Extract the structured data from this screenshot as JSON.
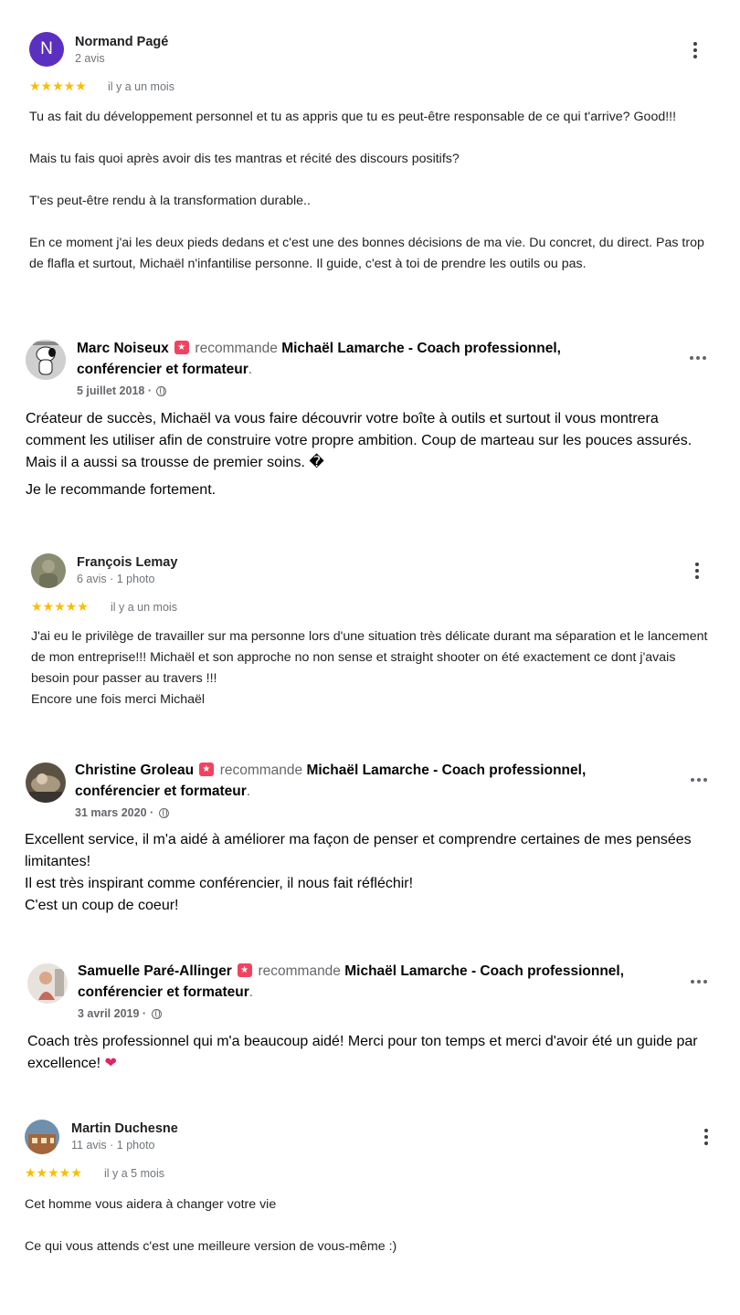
{
  "reviews": [
    {
      "type": "google",
      "avatar_letter": "N",
      "name": "Normand Pagé",
      "meta": "2 avis",
      "stars": "★★★★★",
      "time": "il y a un mois",
      "paragraphs": [
        "Tu as fait du développement personnel et tu as appris que tu es peut-être responsable de ce qui t'arrive? Good!!!",
        "Mais tu fais quoi après avoir dis tes mantras et récité des discours positifs?",
        "T'es peut-être rendu à la transformation durable..",
        "En ce moment j'ai les deux pieds dedans et c'est une des bonnes décisions de ma vie. Du concret, du direct. Pas trop de flafla et surtout, Michaël n'infantilise personne. Il guide, c'est à toi de prendre les outils ou pas."
      ]
    },
    {
      "type": "facebook",
      "name": "Marc Noiseux",
      "recommends": "recommande",
      "page": "Michaël Lamarche - Coach professionnel, conférencier et formateur",
      "date": "5 juillet 2018 ·",
      "paragraphs": [
        "Créateur de succès, Michaël va vous faire découvrir  votre boîte à outils et surtout il vous montrera comment les utiliser afin de construire votre propre ambition. Coup de marteau sur les pouces assurés. Mais il a aussi sa trousse de premier soins. �",
        "Je le recommande fortement."
      ]
    },
    {
      "type": "google",
      "name": "François Lemay",
      "meta": "6 avis · 1 photo",
      "stars": "★★★★★",
      "time": "il y a un mois",
      "paragraphs": [
        "J'ai eu le privilège de travailler sur ma personne lors d'une situation très délicate durant ma séparation et le lancement de mon entreprise!!! Michaël et son approche no non sense et straight shooter on été exactement ce dont j'avais besoin pour passer au travers !!!",
        "Encore une fois merci Michaël"
      ]
    },
    {
      "type": "facebook",
      "name": "Christine Groleau",
      "recommends": "recommande",
      "page": "Michaël Lamarche - Coach professionnel, conférencier et formateur",
      "date": "31 mars 2020 ·",
      "paragraphs": [
        "Excellent service, il m'a aidé à améliorer ma façon de penser et comprendre certaines de mes pensées limitantes!",
        "Il est très inspirant comme conférencier, il nous fait réfléchir!",
        "C'est un coup de coeur!"
      ]
    },
    {
      "type": "facebook",
      "name": "Samuelle Paré-Allinger",
      "recommends": "recommande",
      "page": "Michaël Lamarche - Coach professionnel, conférencier et formateur",
      "date": "3 avril 2019 ·",
      "paragraphs": [
        "Coach très professionnel qui m'a beaucoup aidé! Merci pour ton temps et merci d'avoir été un guide par excellence!"
      ],
      "heart": "❤"
    },
    {
      "type": "google",
      "name": "Martin Duchesne",
      "meta": "11 avis · 1 photo",
      "stars": "★★★★★",
      "time": "il y a 5 mois",
      "paragraphs": [
        "Cet homme vous aidera à changer votre vie",
        "Ce qui vous attends c'est une meilleure version de vous-même :)"
      ]
    }
  ],
  "colors": {
    "star": "#fbbc04",
    "avatar_n": "#5b2fbf",
    "recommend_badge": "#f3425f",
    "heart": "#e0245e"
  },
  "icons": {
    "more_google": "kebab-vertical-icon",
    "more_facebook": "more-horizontal-icon",
    "privacy": "globe-icon",
    "recommend": "recommendation-star-icon"
  }
}
